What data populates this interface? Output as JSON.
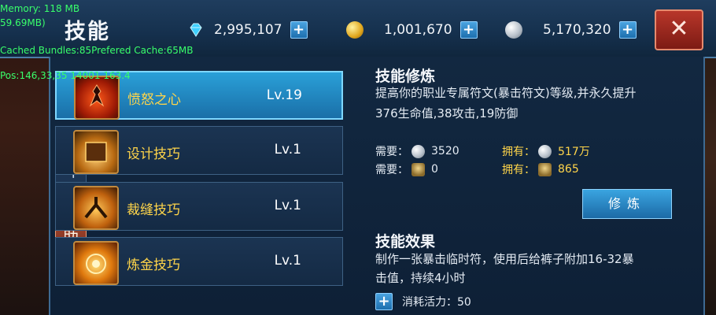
{
  "debug": {
    "memory": "Memory: 118 MB",
    "fps": "59.69MB)",
    "cache": "Cached Bundles:85Prefered Cache:65MB",
    "pos": "Pos:146,33,35  14001  163.4"
  },
  "header": {
    "title": "技能",
    "close_icon": "close-icon",
    "resources": [
      {
        "icon": "diamond-icon",
        "value": "2,995,107"
      },
      {
        "icon": "gold-coin-icon",
        "value": "1,001,670"
      },
      {
        "icon": "silver-coin-icon",
        "value": "5,170,320"
      }
    ]
  },
  "side_tabs": [
    {
      "label": "战斗",
      "active": false
    },
    {
      "label": "辅助",
      "active": true
    }
  ],
  "skills": [
    {
      "name": "愤怒之心",
      "level": "Lv.19",
      "selected": true,
      "icon": "rage-heart-icon"
    },
    {
      "name": "设计技巧",
      "level": "Lv.1",
      "selected": false,
      "icon": "design-skill-icon"
    },
    {
      "name": "裁缝技巧",
      "level": "Lv.1",
      "selected": false,
      "icon": "tailor-skill-icon"
    },
    {
      "name": "炼金技巧",
      "level": "Lv.1",
      "selected": false,
      "icon": "alchemy-skill-icon"
    }
  ],
  "detail": {
    "train_title": "技能修炼",
    "train_desc_line1": "提高你的职业专属符文(暴击符文)等级,并永久提升",
    "train_desc_line2": "376生命值,38攻击,19防御",
    "need_label": "需要：",
    "own_label": "拥有：",
    "need_silver": "3520",
    "need_emblem": "0",
    "own_silver": "517万",
    "own_emblem": "865",
    "train_button": "修炼",
    "effect_title": "技能效果",
    "effect_desc_line1": "制作一张暴击临时符，使用后给裤子附加16-32暴",
    "effect_desc_line2": "击值，持续4小时",
    "consume_label": "消耗活力：50"
  },
  "colors": {
    "accent_blue": "#2aa0d8",
    "skill_name": "#ffd54a",
    "close_red": "#b8362a"
  }
}
